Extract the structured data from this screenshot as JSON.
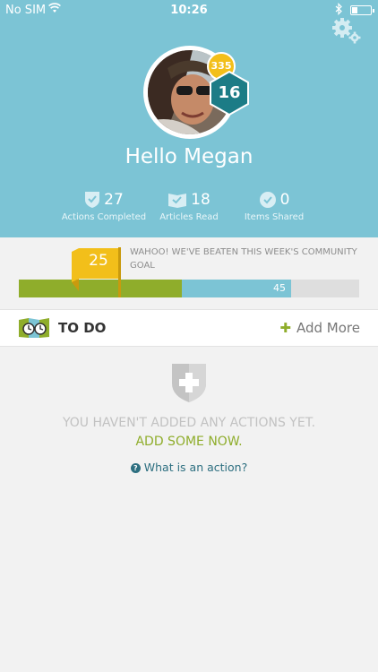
{
  "status_bar": {
    "carrier": "No SIM",
    "time": "10:26",
    "battery_level": 0.3
  },
  "profile": {
    "points": "335",
    "level": "16",
    "greeting": "Hello Megan",
    "stats": [
      {
        "value": "27",
        "label": "Actions Completed",
        "icon": "shield-check-icon"
      },
      {
        "value": "18",
        "label": "Articles Read",
        "icon": "book-check-icon"
      },
      {
        "value": "0",
        "label": "Items Shared",
        "icon": "circle-check-icon"
      }
    ]
  },
  "goal": {
    "flag_value": "25",
    "message": "WAHOO! WE'VE BEATEN THIS WEEK'S COMMUNITY GOAL",
    "community_value": "45",
    "personal_fraction": 0.48,
    "community_fraction": 0.8
  },
  "todo": {
    "title": "TO DO",
    "add_label": "Add More"
  },
  "empty_state": {
    "message": "YOU HAVEN'T ADDED ANY ACTIONS YET.",
    "cta": "ADD SOME NOW.",
    "help_link": "What is an action?"
  },
  "colors": {
    "header": "#7cc4d5",
    "accent_green": "#8fad2b",
    "badge_yellow": "#f2bf1a",
    "level_teal": "#1c7c86"
  }
}
